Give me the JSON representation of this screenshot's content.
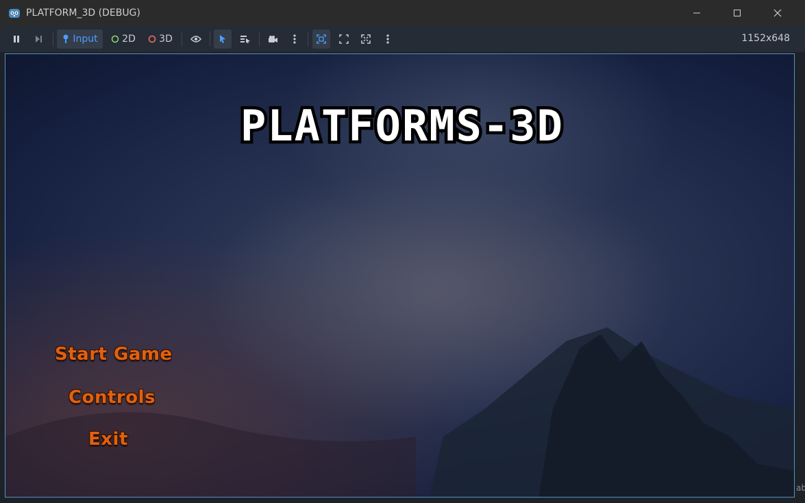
{
  "window": {
    "title": "PLATFORM_3D (DEBUG)",
    "icon": "godot-icon"
  },
  "toolbar": {
    "input_label": "Input",
    "mode_2d_label": "2D",
    "mode_3d_label": "3D",
    "resolution": "1152x648",
    "colors": {
      "accent": "#4a9eff",
      "active_bg": "#353d4a",
      "dot_2d": "#8fd87a",
      "dot_3d": "#f07070"
    }
  },
  "game": {
    "title": "PLATFORMS-3D",
    "menu": {
      "start": "Start Game",
      "controls": "Controls",
      "exit": "Exit"
    },
    "menu_color": "#e2600f"
  },
  "side_glimpse": "ab"
}
